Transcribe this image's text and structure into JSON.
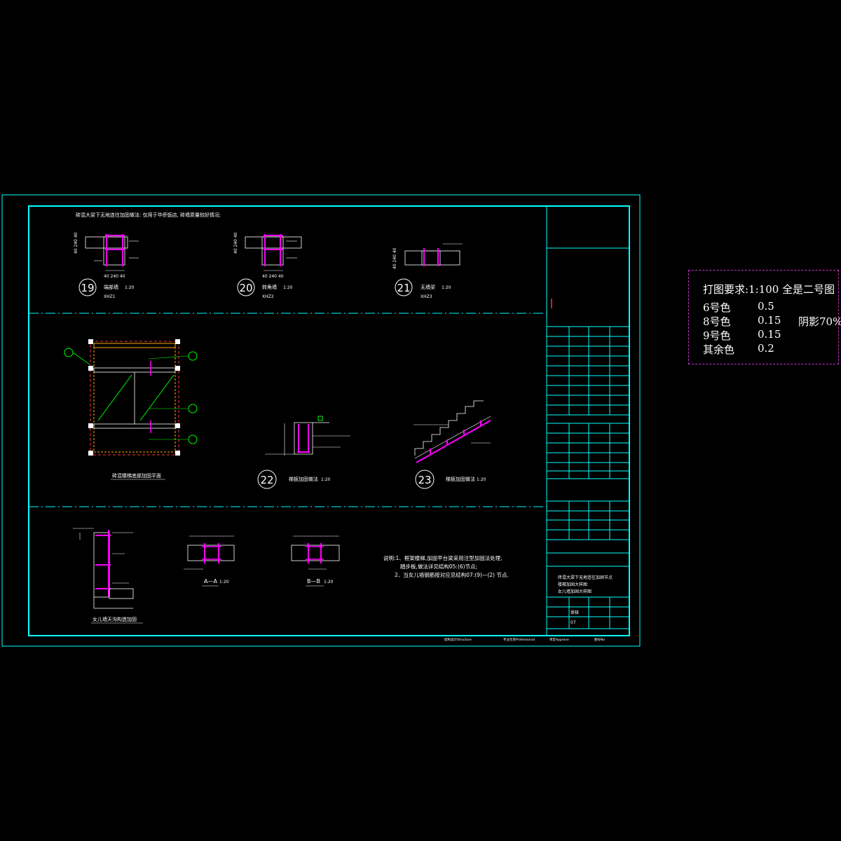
{
  "top_note": "砖混大梁下无地连往加固做法:  仅用于华侨饭店,  砖墙质量较好情况:",
  "details": [
    {
      "num": "19",
      "title": "端部墙",
      "scale": "1:20",
      "code": "XHZ1"
    },
    {
      "num": "20",
      "title": "转角墙",
      "scale": "1:20",
      "code": "XHZ2"
    },
    {
      "num": "21",
      "title": "无墙梁",
      "scale": "1:20",
      "code": "XHZ3"
    },
    {
      "num": "22",
      "title": "梯板加固做法",
      "scale": "1:20"
    },
    {
      "num": "23",
      "title": "梯板加固做法",
      "scale": "1:20"
    }
  ],
  "dims": {
    "d1": "40 240 40",
    "d2": "40 240 40",
    "d3": "40 240 40"
  },
  "plan_title": "砖混楼梯底部加固平面",
  "parapet_title": "女儿墙天沟构造加固",
  "section_a": "A—A",
  "section_b": "B—B",
  "section_scale": "1:20",
  "notes": [
    "说明:1、框架楼梯,加固平台梁采用注型加固法处理,",
    "踏步板,做法详见结构05:(6)节点;",
    "2、当女儿墙钢筋按对应见结构07:(9)—(2) 节点."
  ],
  "title_block": {
    "project_title_lines": [
      "砖混大梁下无地连往加固节点",
      "楼梯加固大样图",
      "女儿墙加固大样图"
    ],
    "drawing_no": "07",
    "checker": "审核"
  },
  "footer": [
    "结构设计Structure",
    "专业负责Professional",
    "审定Approve",
    "图号No"
  ],
  "print_requirements": {
    "title": "打图要求:1:100  全是二号图",
    "rows": [
      {
        "label": "6号色",
        "value": "0.5",
        "extra": ""
      },
      {
        "label": "8号色",
        "value": "0.15",
        "extra": "阴影70%"
      },
      {
        "label": "9号色",
        "value": "0.15",
        "extra": ""
      },
      {
        "label": "其余色",
        "value": "0.2",
        "extra": ""
      }
    ]
  },
  "colors": {
    "frame": "#00ffff",
    "text": "#ffffff",
    "rebar": "#ff00ff",
    "red": "#ff3333",
    "green": "#00ff00",
    "note_border": "#cc33cc"
  }
}
